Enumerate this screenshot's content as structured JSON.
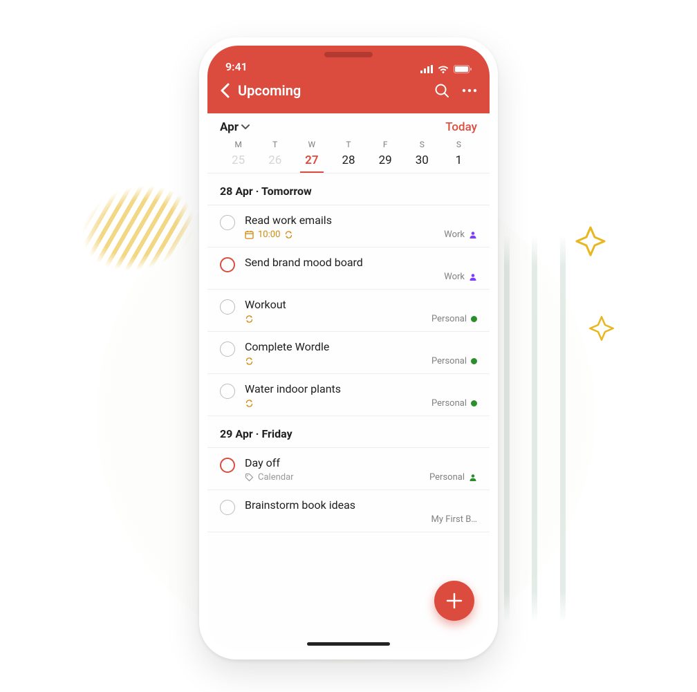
{
  "status": {
    "time": "9:41"
  },
  "header": {
    "title": "Upcoming"
  },
  "calendar": {
    "month_label": "Apr",
    "today_label": "Today",
    "days": [
      {
        "dow": "M",
        "num": "25",
        "state": "past",
        "has_dot": false
      },
      {
        "dow": "T",
        "num": "26",
        "state": "past",
        "has_dot": false
      },
      {
        "dow": "W",
        "num": "27",
        "state": "current",
        "has_dot": true
      },
      {
        "dow": "T",
        "num": "28",
        "state": "future",
        "has_dot": true
      },
      {
        "dow": "F",
        "num": "29",
        "state": "future",
        "has_dot": true
      },
      {
        "dow": "S",
        "num": "30",
        "state": "future",
        "has_dot": true
      },
      {
        "dow": "S",
        "num": "1",
        "state": "future",
        "has_dot": true
      }
    ]
  },
  "sections": [
    {
      "heading": "28 Apr · Tomorrow",
      "tasks": [
        {
          "title": "Read work emails",
          "priority": false,
          "time": "10:00",
          "has_calendar_icon": true,
          "recurring": true,
          "project": {
            "name": "Work",
            "icon": "person",
            "color": "#7d3cff"
          },
          "label": null
        },
        {
          "title": "Send brand mood board",
          "priority": true,
          "time": null,
          "has_calendar_icon": false,
          "recurring": false,
          "project": {
            "name": "Work",
            "icon": "person",
            "color": "#7d3cff"
          },
          "label": null
        },
        {
          "title": "Workout",
          "priority": false,
          "time": null,
          "has_calendar_icon": false,
          "recurring": true,
          "project": {
            "name": "Personal",
            "icon": "dot",
            "color": "#2a8f2a"
          },
          "label": null
        },
        {
          "title": "Complete Wordle",
          "priority": false,
          "time": null,
          "has_calendar_icon": false,
          "recurring": true,
          "project": {
            "name": "Personal",
            "icon": "dot",
            "color": "#2a8f2a"
          },
          "label": null
        },
        {
          "title": "Water indoor plants",
          "priority": false,
          "time": null,
          "has_calendar_icon": false,
          "recurring": true,
          "project": {
            "name": "Personal",
            "icon": "dot",
            "color": "#2a8f2a"
          },
          "label": null
        }
      ]
    },
    {
      "heading": "29 Apr · Friday",
      "tasks": [
        {
          "title": "Day off",
          "priority": true,
          "time": null,
          "has_calendar_icon": false,
          "recurring": false,
          "project": {
            "name": "Personal",
            "icon": "person",
            "color": "#2a8f2a"
          },
          "label": "Calendar"
        },
        {
          "title": "Brainstorm book ideas",
          "priority": false,
          "time": null,
          "has_calendar_icon": false,
          "recurring": false,
          "project": {
            "name": "My First B…",
            "icon": "none",
            "color": null
          },
          "label": null
        }
      ]
    }
  ],
  "colors": {
    "accent": "#db4c3f",
    "amber": "#d1880c"
  }
}
